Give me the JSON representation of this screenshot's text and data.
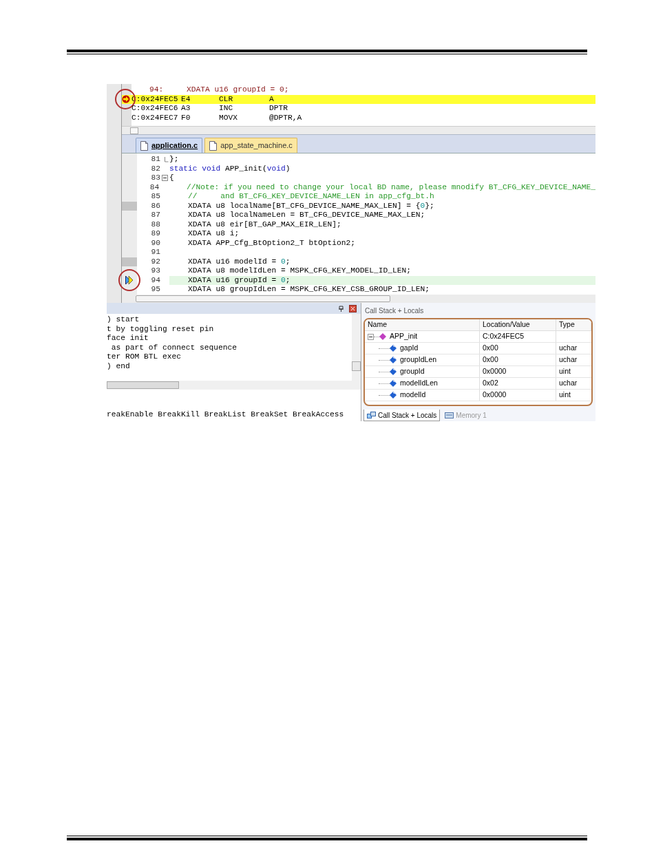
{
  "disassembly": {
    "source_line": {
      "number": "94:",
      "code": "XDATA u16 groupId = 0;"
    },
    "instructions": [
      {
        "address": "C:0x24FEC5",
        "opcode": "E4",
        "mnemonic": "CLR",
        "operand": "A",
        "current": true
      },
      {
        "address": "C:0x24FEC6",
        "opcode": "A3",
        "mnemonic": "INC",
        "operand": "DPTR",
        "current": false
      },
      {
        "address": "C:0x24FEC7",
        "opcode": "F0",
        "mnemonic": "MOVX",
        "operand": "@DPTR,A",
        "current": false
      }
    ]
  },
  "editor_tabs": [
    {
      "label": "application.c",
      "selected": true
    },
    {
      "label": "app_state_machine.c",
      "selected": false
    }
  ],
  "editor": {
    "lines": [
      {
        "number": "81",
        "kind": "fold_end",
        "marked": false,
        "current": false,
        "segments": [
          {
            "text": "};",
            "kind": "plain"
          }
        ]
      },
      {
        "number": "82",
        "marked": false,
        "current": false,
        "segments": [
          {
            "text": "static void",
            "kind": "keyword"
          },
          {
            "text": " APP_init(",
            "kind": "plain"
          },
          {
            "text": "void",
            "kind": "keyword"
          },
          {
            "text": ")",
            "kind": "plain"
          }
        ]
      },
      {
        "number": "83",
        "kind": "fold_start",
        "marked": false,
        "current": false,
        "segments": [
          {
            "text": "{",
            "kind": "plain"
          }
        ]
      },
      {
        "number": "84",
        "marked": false,
        "current": false,
        "segments": [
          {
            "text": "    //Note: if you need to change your local BD name, please mnodify BT_CFG_KEY_DEVICE_NAME_",
            "kind": "comment"
          }
        ]
      },
      {
        "number": "85",
        "marked": false,
        "current": false,
        "segments": [
          {
            "text": "    //     and BT_CFG_KEY_DEVICE_NAME_LEN in app_cfg_bt.h",
            "kind": "comment"
          }
        ]
      },
      {
        "number": "86",
        "marked": true,
        "current": false,
        "segments": [
          {
            "text": "    XDATA u8 localName[BT_CFG_DEVICE_NAME_MAX_LEN] = {",
            "kind": "plain"
          },
          {
            "text": "0",
            "kind": "number"
          },
          {
            "text": "};",
            "kind": "plain"
          }
        ]
      },
      {
        "number": "87",
        "marked": false,
        "current": false,
        "segments": [
          {
            "text": "    XDATA u8 localNameLen = BT_CFG_DEVICE_NAME_MAX_LEN;",
            "kind": "plain"
          }
        ]
      },
      {
        "number": "88",
        "marked": false,
        "current": false,
        "segments": [
          {
            "text": "    XDATA u8 eir[BT_GAP_MAX_EIR_LEN];",
            "kind": "plain"
          }
        ]
      },
      {
        "number": "89",
        "marked": false,
        "current": false,
        "segments": [
          {
            "text": "    XDATA u8 i;",
            "kind": "plain"
          }
        ]
      },
      {
        "number": "90",
        "marked": false,
        "current": false,
        "segments": [
          {
            "text": "    XDATA APP_Cfg_BtOption2_T btOption2;",
            "kind": "plain"
          }
        ]
      },
      {
        "number": "91",
        "marked": false,
        "current": false
      },
      {
        "number": "92",
        "marked": true,
        "current": false,
        "segments": [
          {
            "text": "    XDATA u16 modelId = ",
            "kind": "plain"
          },
          {
            "text": "0",
            "kind": "number"
          },
          {
            "text": ";",
            "kind": "plain"
          }
        ]
      },
      {
        "number": "93",
        "marked": false,
        "current": false,
        "segments": [
          {
            "text": "    XDATA u8 modelIdLen = MSPK_CFG_KEY_MODEL_ID_LEN;",
            "kind": "plain"
          }
        ]
      },
      {
        "number": "94",
        "marked": false,
        "current": true,
        "segments": [
          {
            "text": "    XDATA u16 groupId = ",
            "kind": "plain"
          },
          {
            "text": "0",
            "kind": "number"
          },
          {
            "text": ";",
            "kind": "plain"
          }
        ]
      },
      {
        "number": "95",
        "marked": false,
        "current": false,
        "segments": [
          {
            "text": "    XDATA u8 groupIdLen = MSPK_CFG_KEY_CSB_GROUP_ID_LEN;",
            "kind": "plain"
          }
        ]
      }
    ]
  },
  "output_panel": {
    "lines": [
      ") start",
      "t by toggling reset pin",
      "face init",
      " as part of connect sequence",
      "ter ROM BTL exec",
      ") end"
    ],
    "command_line": "reakEnable BreakKill BreakList BreakSet BreakAccess"
  },
  "call_stack_locals": {
    "title": "Call Stack + Locals",
    "columns": [
      "Name",
      "Location/Value",
      "Type"
    ],
    "rows": [
      {
        "name": "APP_init",
        "kind": "function",
        "value": "C:0x24FEC5",
        "expanded": true,
        "children": [
          {
            "name": "gapId",
            "kind": "variable",
            "value": "0x00",
            "type": "uchar"
          },
          {
            "name": "groupIdLen",
            "kind": "variable",
            "value": "0x00",
            "type": "uchar"
          },
          {
            "name": "groupId",
            "kind": "variable",
            "value": "0x0000",
            "type": "uint"
          },
          {
            "name": "modelIdLen",
            "kind": "variable",
            "value": "0x02",
            "type": "uchar"
          },
          {
            "name": "modelId",
            "kind": "variable",
            "value": "0x0000",
            "type": "uint"
          }
        ]
      }
    ]
  },
  "bottom_tabs": [
    {
      "label": "Call Stack + Locals",
      "selected": true
    },
    {
      "label": "Memory 1",
      "selected": false
    }
  ]
}
